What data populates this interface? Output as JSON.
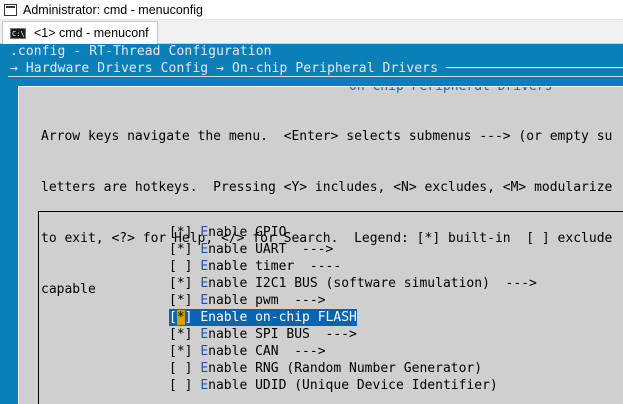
{
  "window": {
    "title": "Administrator: cmd - menuconfig",
    "tab_label": "<1> cmd - menuconf",
    "tab_icon_text": "C:\\"
  },
  "console": {
    "header_line1": ".config - RT-Thread Configuration",
    "header_line2": "→ Hardware Drivers Config → On-chip Peripheral Drivers ───────────────────────"
  },
  "dialog": {
    "title": "On-chip Peripheral Drivers",
    "help_lines": [
      "Arrow keys navigate the menu.  <Enter> selects submenus ---> (or empty su",
      "letters are hotkeys.  Pressing <Y> includes, <N> excludes, <M> modularize",
      "to exit, <?> for Help, </> for Search.  Legend: [*] built-in  [ ] exclude",
      "capable"
    ]
  },
  "menu": {
    "items": [
      {
        "mark": "[*] ",
        "hotkey": "E",
        "label": "nable GPIO"
      },
      {
        "mark": "[*] ",
        "hotkey": "E",
        "label": "nable UART  --->"
      },
      {
        "mark": "[ ] ",
        "hotkey": "E",
        "label": "nable timer  ----"
      },
      {
        "mark": "[*] ",
        "hotkey": "E",
        "label": "nable I2C1 BUS (software simulation)  --->"
      },
      {
        "mark": "[*] ",
        "hotkey": "E",
        "label": "nable pwm  --->"
      },
      {
        "mark_open": "[",
        "mark_cursor": "*",
        "mark_close": "] ",
        "hotkey": "E",
        "label": "nable on-chip FLASH",
        "selected": true
      },
      {
        "mark": "[*] ",
        "hotkey": "E",
        "label": "nable SPI BUS  --->"
      },
      {
        "mark": "[*] ",
        "hotkey": "E",
        "label": "nable CAN  --->"
      },
      {
        "mark": "[ ] ",
        "hotkey": "E",
        "label": "nable RNG (Random Number Generator)"
      },
      {
        "mark": "[ ] ",
        "hotkey": "E",
        "label": "nable UDID (Unique Device Identifier)"
      }
    ]
  },
  "colors": {
    "console_bg": "#0a7fb8",
    "dialog_bg": "#cfcfcf",
    "highlight": "#0a64b0",
    "cursor": "#d4a000",
    "hotkey": "#1d57b0"
  }
}
